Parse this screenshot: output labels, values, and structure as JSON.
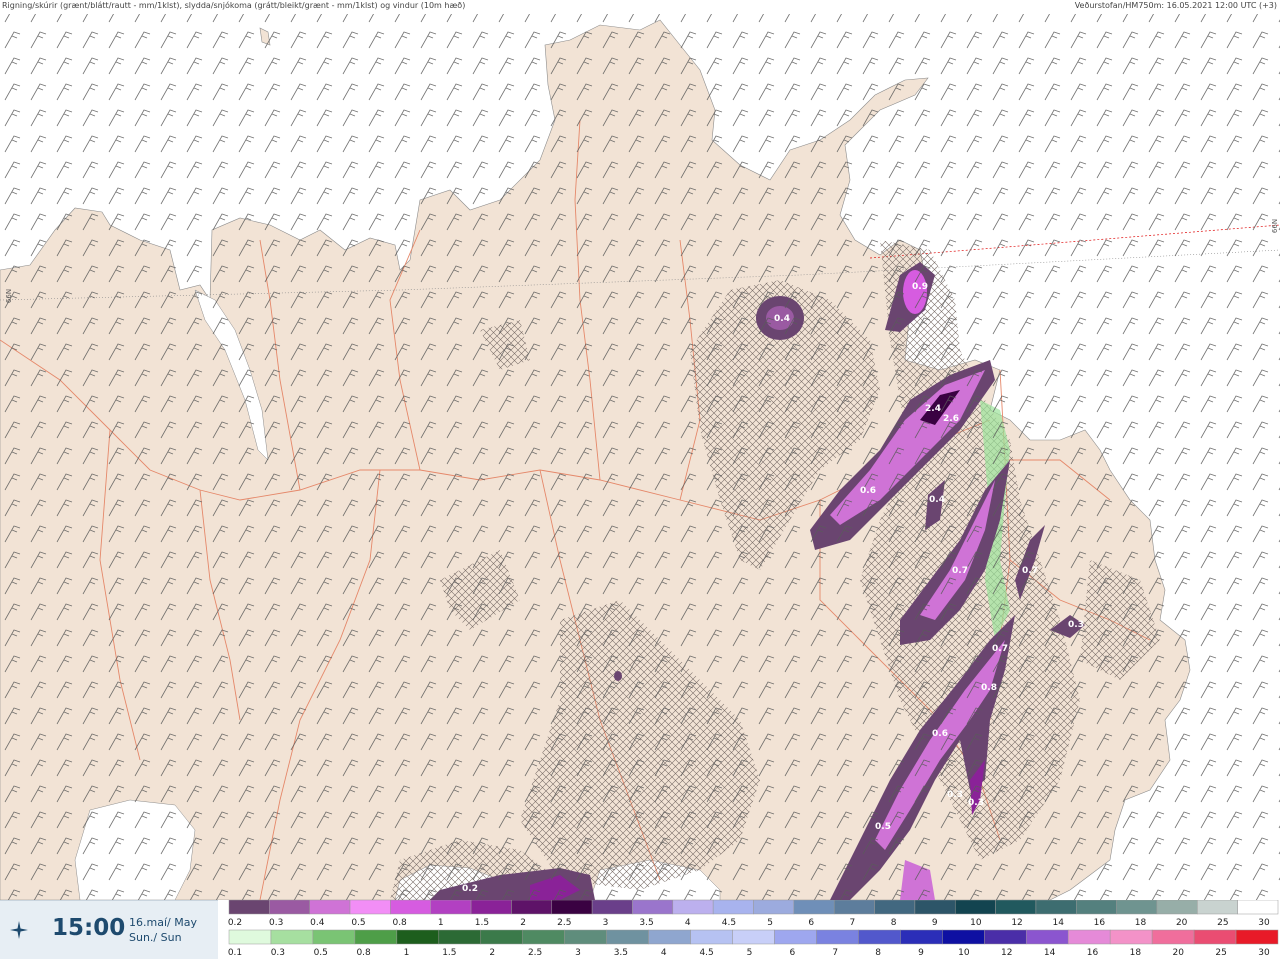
{
  "header": {
    "left": "Rigning/skúrir (grænt/blátt/rautt - mm/1klst), slydda/snjókoma (grátt/bleikt/grænt - mm/1klst) og vindur (10m hæð)",
    "right": "Veðurstofan/HM750m: 16.05.2021 12:00 UTC (+3)"
  },
  "gridlabels": {
    "left": "66N",
    "right": "66N"
  },
  "footer": {
    "time": "15:00",
    "date_line1": "16.maí/ May",
    "date_line2": "Sun./ Sun"
  },
  "legend_top": {
    "labels": [
      "0.2",
      "0.3",
      "0.4",
      "0.5",
      "0.8",
      "1",
      "1.5",
      "2",
      "2.5",
      "3",
      "3.5",
      "4",
      "4.5",
      "5",
      "6",
      "7",
      "8",
      "9",
      "10",
      "12",
      "14",
      "16",
      "18",
      "20",
      "25",
      "30"
    ],
    "colors": [
      "#6a4570",
      "#9a5aa2",
      "#cf73d6",
      "#f28ef6",
      "#d65ce0",
      "#b240c2",
      "#8a2298",
      "#5e1368",
      "#3a0242",
      "#6a3f8a",
      "#9a75cc",
      "#bcb0ee",
      "#a8b3ee",
      "#9cabde",
      "#6f8fb8",
      "#5d7d9c",
      "#426880",
      "#2d5568",
      "#134450",
      "#21595e",
      "#3d6d70",
      "#54807e",
      "#6f9490",
      "#97aea8",
      "#c9d3d0",
      "#ffffff"
    ]
  },
  "legend_bottom": {
    "labels": [
      "0.1",
      "0.3",
      "0.5",
      "0.8",
      "1",
      "1.5",
      "2",
      "2.5",
      "3",
      "3.5",
      "4",
      "4.5",
      "5",
      "6",
      "7",
      "8",
      "9",
      "10",
      "12",
      "14",
      "16",
      "18",
      "20",
      "25",
      "30"
    ],
    "colors": [
      "#dffadd",
      "#a6dfa0",
      "#7ac474",
      "#4e9e48",
      "#1d5e1d",
      "#2c6a35",
      "#3b7a4a",
      "#4f8a62",
      "#5f8d7c",
      "#6f92a0",
      "#8fa6cf",
      "#b6c2f2",
      "#c8cff8",
      "#9ea7ef",
      "#7a82e0",
      "#5258cc",
      "#2b2eb8",
      "#0e10a2",
      "#4a2ea8",
      "#8b55cf",
      "#e58ad8",
      "#f392c8",
      "#f06e9c",
      "#ea4d72",
      "#e81a28"
    ]
  },
  "precip_labels": [
    {
      "text": "0.4"
    },
    {
      "text": "0.9"
    },
    {
      "text": "2.4"
    },
    {
      "text": "2.6"
    },
    {
      "text": "0.6"
    },
    {
      "text": "0.4"
    },
    {
      "text": "0.7"
    },
    {
      "text": "0.7"
    },
    {
      "text": "0.3"
    },
    {
      "text": "0.7"
    },
    {
      "text": "0.8"
    },
    {
      "text": "0.6"
    },
    {
      "text": "0.3"
    },
    {
      "text": "0.5"
    },
    {
      "text": "0.2"
    },
    {
      "text": "0.3"
    }
  ],
  "map": {
    "sea_color": "#ffffff",
    "land_color": "#f2e3d5",
    "road_color": "#e5886a",
    "wind_color": "#555555"
  }
}
